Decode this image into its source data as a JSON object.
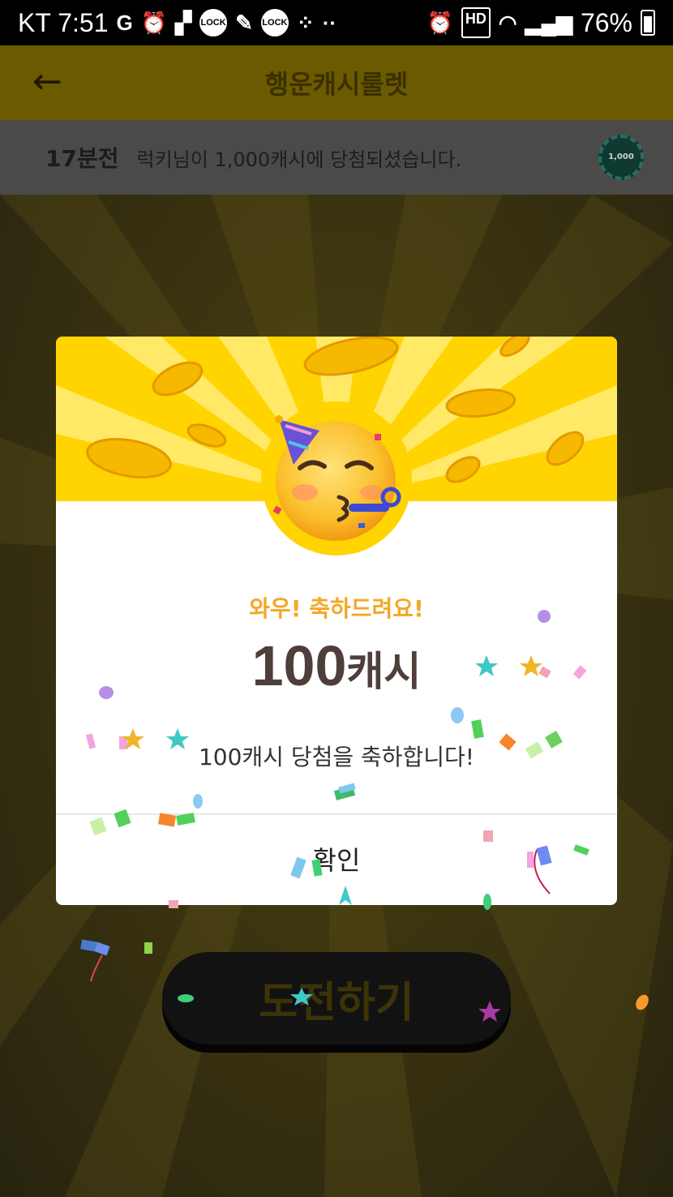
{
  "status_bar": {
    "carrier_time": "KT 7:51",
    "battery_percent": "76%"
  },
  "app_bar": {
    "title": "행운캐시룰렛"
  },
  "ticker": {
    "time_ago": "17분전",
    "message": "럭키님이 1,000캐시에 당첨되셨습니다.",
    "coin_label": "1,000"
  },
  "modal": {
    "heading": "와우! 축하드려요!",
    "amount_number": "100",
    "amount_unit": "캐시",
    "description": "100캐시 당첨을 축하합니다!",
    "confirm_label": "확인"
  },
  "challenge_button": {
    "label": "도전하기"
  },
  "colors": {
    "banner_yellow": "#ffd400",
    "heading_orange": "#f3a826",
    "amount_brown": "#4e3f3a"
  }
}
